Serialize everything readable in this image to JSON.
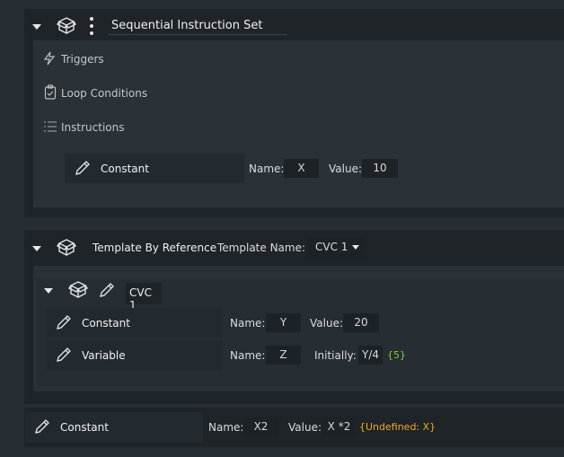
{
  "block1": {
    "title": "Sequential Instruction Set",
    "sections": {
      "triggers": "Triggers",
      "loop_conditions": "Loop Conditions",
      "instructions": "Instructions"
    },
    "instruction": {
      "type": "Constant",
      "name_label": "Name:",
      "name_value": "X",
      "value_label": "Value:",
      "value_value": "10"
    }
  },
  "block2": {
    "title": "Template By Reference",
    "template_name_label": "Template Name:",
    "template_name_value": "CVC 1",
    "inner_title": "CVC 1",
    "rows": [
      {
        "type": "Constant",
        "name_label": "Name:",
        "name_value": "Y",
        "value_label": "Value:",
        "value_value": "20",
        "result": ""
      },
      {
        "type": "Variable",
        "name_label": "Name:",
        "name_value": "Z",
        "value_label": "Initially:",
        "value_value": "Y/4",
        "result": "{5}"
      }
    ]
  },
  "block3": {
    "type": "Constant",
    "name_label": "Name:",
    "name_value": "X2",
    "value_label": "Value:",
    "value_value": "X *2",
    "result": "{Undefined: X}"
  },
  "colors": {
    "result_ok": "#7cd12f",
    "result_error": "#f5a623"
  }
}
